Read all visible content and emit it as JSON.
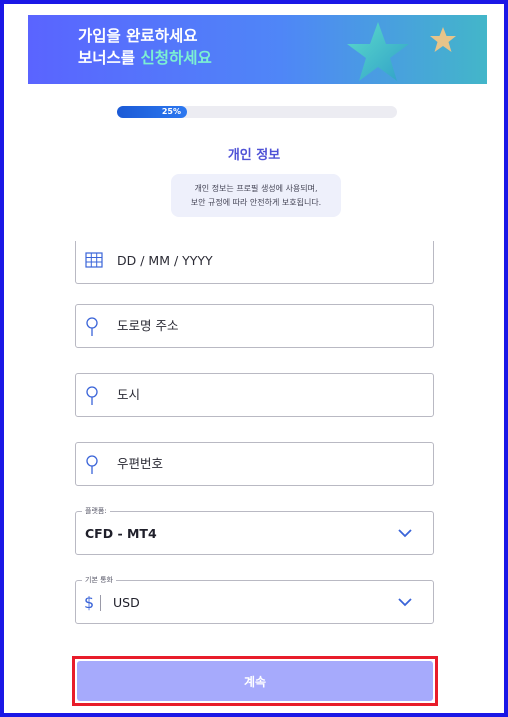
{
  "banner": {
    "line1": "가입을 완료하세요",
    "line2_prefix": "보너스를 ",
    "line2_accent": "신청하세요"
  },
  "progress": {
    "label": "25%",
    "fraction": 0.25
  },
  "page_title": "개인 정보",
  "info": {
    "line1": "개인 정보는 프로필 생성에 사용되며,",
    "line2": "보안 규정에 따라 안전하게 보호됩니다."
  },
  "form": {
    "date_placeholder": "DD / MM / YYYY",
    "address_placeholder": "도로명 주소",
    "city_placeholder": "도시",
    "postal_placeholder": "우편번호",
    "platform": {
      "label": "플랫폼:",
      "value": "CFD - MT4"
    },
    "currency": {
      "label": "기본 통화",
      "symbol": "$",
      "value": "USD"
    }
  },
  "continue_label": "계속",
  "colors": {
    "accent": "#4f52d6",
    "banner_accent": "#7cf0d2",
    "button": "#a6aafc",
    "highlight": "#e81c2a"
  }
}
